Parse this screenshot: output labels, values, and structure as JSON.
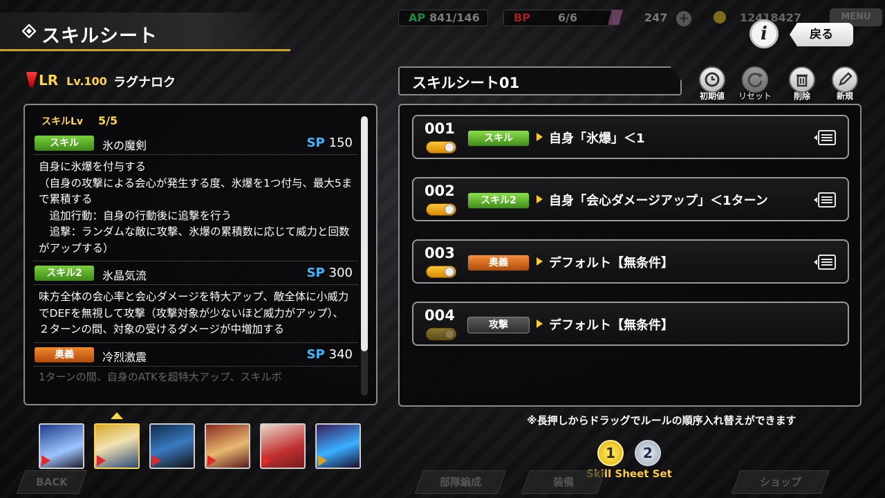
{
  "header": {
    "title": "スキルシート",
    "info_label": "i",
    "back_label": "戻る"
  },
  "status": {
    "ap_key": "AP",
    "ap_value": "841/146",
    "bp_key": "BP",
    "bp_value": "6/6",
    "coin_value": "247",
    "money_value": "12418427",
    "menu_label": "MENU"
  },
  "character": {
    "rarity": "LR",
    "level": "Lv.100",
    "name": "ラグナロク"
  },
  "skill_panel": {
    "skill_lv_label": "スキルLv",
    "skill_lv_value": "5/5",
    "sp_label": "SP",
    "skills": [
      {
        "tag": "スキル",
        "name": "氷の魔剣",
        "sp": "150",
        "desc": "自身に氷爆を付与する\n（自身の攻撃による会心が発生する度、氷爆を1つ付与、最大5まで累積する\n　追加行動：自身の行動後に追撃を行う\n　追撃：ランダムな敵に攻撃、氷爆の累積数に応じて威力と回数がアップする）"
      },
      {
        "tag": "スキル2",
        "name": "氷晶気流",
        "sp": "300",
        "desc": "味方全体の会心率と会心ダメージを特大アップ、敵全体に小威力でDEFを無視して攻撃（攻撃対象が少ないほど威力がアップ）、２ターンの間、対象の受けるダメージが中増加する"
      },
      {
        "tag": "奥義",
        "name": "冷烈激震",
        "sp": "340",
        "desc": "1ターンの間、自身のATKを超特大アップ、スキルボ"
      }
    ]
  },
  "sheet": {
    "title": "スキルシート01",
    "tools": [
      {
        "label": "初期値",
        "enabled": true
      },
      {
        "label": "リセット",
        "enabled": false
      },
      {
        "label": "削除",
        "enabled": true
      },
      {
        "label": "新規",
        "enabled": true
      }
    ],
    "rules": [
      {
        "num": "001",
        "tag": "スキル",
        "tag_color": "green",
        "condition": "自身「氷爆」＜1",
        "active": true,
        "handle": true
      },
      {
        "num": "002",
        "tag": "スキル2",
        "tag_color": "green",
        "condition": "自身「会心ダメージアップ」＜1ターン",
        "active": true,
        "handle": true
      },
      {
        "num": "003",
        "tag": "奥義",
        "tag_color": "orange",
        "condition": "デフォルト【無条件】",
        "active": true,
        "handle": true
      },
      {
        "num": "004",
        "tag": "攻撃",
        "tag_color": "gray",
        "condition": "デフォルト【無条件】",
        "active": false,
        "handle": false
      }
    ],
    "note": "※長押しからドラッグでルールの順序入れ替えができます"
  },
  "party": {
    "selected_index": 1,
    "members": [
      {
        "name": "party-member-1",
        "colors": [
          "#1e3a8a",
          "#9ec5ff"
        ]
      },
      {
        "name": "party-member-2",
        "colors": [
          "#d4a82a",
          "#2a4a7a"
        ]
      },
      {
        "name": "party-member-3",
        "colors": [
          "#0e2a4a",
          "#3a7ac0"
        ]
      },
      {
        "name": "party-member-4",
        "colors": [
          "#8a2a1e",
          "#e8b870"
        ]
      },
      {
        "name": "party-member-5",
        "colors": [
          "#e8d8c8",
          "#c03030"
        ]
      },
      {
        "name": "party-member-6",
        "colors": [
          "#3a1a5a",
          "#3ab0ff"
        ]
      }
    ]
  },
  "skill_sheet_set": {
    "label": "Skill Sheet Set",
    "buttons": [
      "1",
      "2"
    ],
    "selected": "1"
  },
  "bottom_nav": {
    "items": [
      "BACK",
      "部隊編成",
      "装備",
      "ショップ"
    ]
  }
}
